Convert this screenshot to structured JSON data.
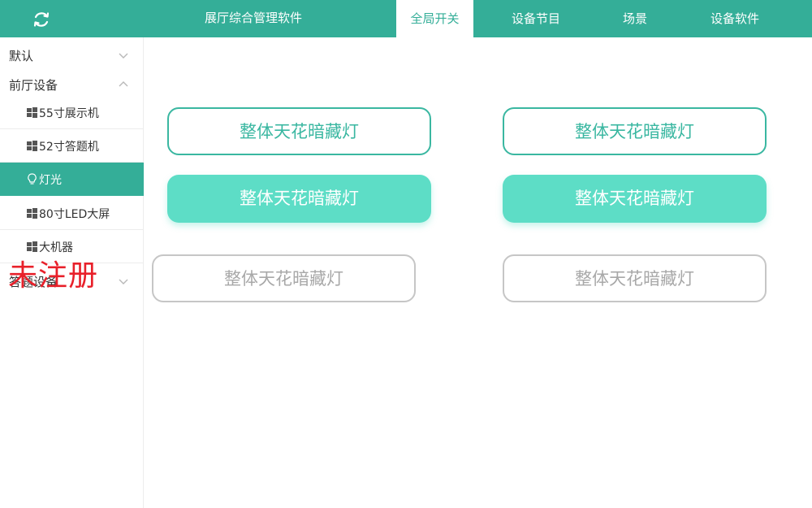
{
  "header": {
    "title": "展厅综合管理软件",
    "tabs": [
      {
        "label": "全局开关",
        "active": true
      },
      {
        "label": "设备节目",
        "active": false
      },
      {
        "label": "场景",
        "active": false
      },
      {
        "label": "设备软件",
        "active": false
      }
    ]
  },
  "sidebar": {
    "groups": [
      {
        "label": "默认",
        "expanded": false
      },
      {
        "label": "前厅设备",
        "expanded": true,
        "items": [
          {
            "label": "55寸展示机",
            "icon": "windows-icon"
          },
          {
            "label": "52寸答题机",
            "icon": "windows-icon"
          },
          {
            "label": "灯光",
            "icon": "lightbulb-icon",
            "active": true
          },
          {
            "label": "80寸LED大屏",
            "icon": "windows-icon"
          },
          {
            "label": "大机器",
            "icon": "windows-icon"
          }
        ]
      },
      {
        "label": "答题设备",
        "expanded": false
      }
    ]
  },
  "controls": [
    {
      "label": "整体天花暗藏灯",
      "state": "outline"
    },
    {
      "label": "整体天花暗藏灯",
      "state": "outline"
    },
    {
      "label": "整体天花暗藏灯",
      "state": "filled"
    },
    {
      "label": "整体天花暗藏灯",
      "state": "filled"
    },
    {
      "label": "整体天花暗藏灯",
      "state": "disabled"
    },
    {
      "label": "整体天花暗藏灯",
      "state": "disabled"
    }
  ],
  "watermark": "未注册",
  "colors": {
    "accent": "#34ae98",
    "active_button": "#5dddc6",
    "disabled": "#c6c6c6",
    "watermark": "#e8202a"
  }
}
